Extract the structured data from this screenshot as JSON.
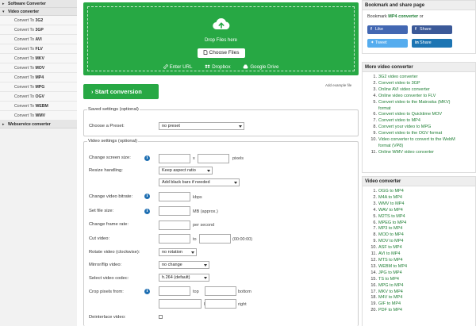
{
  "sidebar": {
    "categories": [
      {
        "label": "Software Converter",
        "expanded": false
      },
      {
        "label": "Video converter",
        "expanded": true
      },
      {
        "label": "Webservice converter",
        "expanded": false
      }
    ],
    "items": [
      {
        "prefix": "Convert To ",
        "format": "3G2"
      },
      {
        "prefix": "Convert To ",
        "format": "3GP"
      },
      {
        "prefix": "Convert To ",
        "format": "AVI"
      },
      {
        "prefix": "Convert To ",
        "format": "FLV"
      },
      {
        "prefix": "Convert To ",
        "format": "MKV"
      },
      {
        "prefix": "Convert To ",
        "format": "MOV"
      },
      {
        "prefix": "Convert To ",
        "format": "MP4"
      },
      {
        "prefix": "Convert To ",
        "format": "MPG"
      },
      {
        "prefix": "Convert To ",
        "format": "OGV"
      },
      {
        "prefix": "Convert To ",
        "format": "WEBM"
      },
      {
        "prefix": "Convert To ",
        "format": "WMV"
      }
    ]
  },
  "upload": {
    "drop_text": "Drop Files here",
    "choose_label": "Choose Files",
    "enter_url": "Enter URL",
    "dropbox": "Dropbox",
    "google_drive": "Google Drive"
  },
  "actions": {
    "start_label": "Start conversion",
    "add_example": "Add example file"
  },
  "saved_settings": {
    "legend": "Saved settings (optional)",
    "preset_label": "Choose a Preset:",
    "preset_value": "no preset"
  },
  "video_settings": {
    "legend": "Video settings (optional)",
    "screen_size_label": "Change screen size:",
    "x_sep": "x",
    "pixels_unit": "pixels",
    "resize_label": "Resize handling:",
    "resize_value": "Keep aspect ratio",
    "black_bars_value": "Add black bars if needed",
    "bitrate_label": "Change video bitrate:",
    "bitrate_unit": "kbps",
    "file_size_label": "Set file size:",
    "file_size_unit": "MB (approx.)",
    "frame_rate_label": "Change frame rate:",
    "frame_rate_unit": "per second",
    "cut_label": "Cut video:",
    "cut_to": "to",
    "cut_hint": "(00:00:00)",
    "rotate_label": "Rotate video (clockwise):",
    "rotate_value": "no rotation",
    "mirror_label": "Mirror/flip video:",
    "mirror_value": "no change",
    "codec_label": "Select video codec:",
    "codec_value": "h.264 (default)",
    "crop_label": "Crop pixels from:",
    "crop_top": "top",
    "crop_bottom": "bottom",
    "crop_left": "left",
    "crop_right": "right",
    "deinterlace_label": "Deinterlace video:"
  },
  "share": {
    "title": "Bookmark and share page",
    "bookmark_prefix": "Bookmark ",
    "bookmark_link": "MP4 converter",
    "bookmark_suffix": " or",
    "like": "Like",
    "fb_share": "Share",
    "tweet": "Tweet",
    "li_share": "Share"
  },
  "more_converters": {
    "title": "More video converter",
    "items": [
      "3G2 video converter",
      "Convert video to 3GP",
      "Online AVI video converter",
      "Online video converter to FLV",
      "Convert video to the Matroska (MKV)",
      "format",
      "Convert video to Quicktime MOV",
      "Convert video to MP4",
      "Convert your video to MPG",
      "Convert video to the OGV format",
      "Video converter to convert to the WebM",
      "format (VP8)",
      "Online WMV video converter"
    ]
  },
  "video_converter": {
    "title": "Video converter",
    "items": [
      "OGG to MP4",
      "M4A to MP4",
      "WMV to MP4",
      "WAV to MP4",
      "M2TS to MP4",
      "MPEG to MP4",
      "MP3 to MP4",
      "MOD to MP4",
      "MOV to MP4",
      "ASF to MP4",
      "AVI to MP4",
      "MTS to MP4",
      "WEBM to MP4",
      "JPG to MP4",
      "TS to MP4",
      "MPG to MP4",
      "MKV to MP4",
      "M4V to MP4",
      "GIF to MP4",
      "PDF to MP4"
    ]
  },
  "colors": {
    "accent_green": "#27a844",
    "link_green": "#1e7e34",
    "info_blue": "#1f6fb2",
    "facebook": "#3b5998",
    "twitter": "#55acee",
    "linkedin": "#1d75b3"
  }
}
